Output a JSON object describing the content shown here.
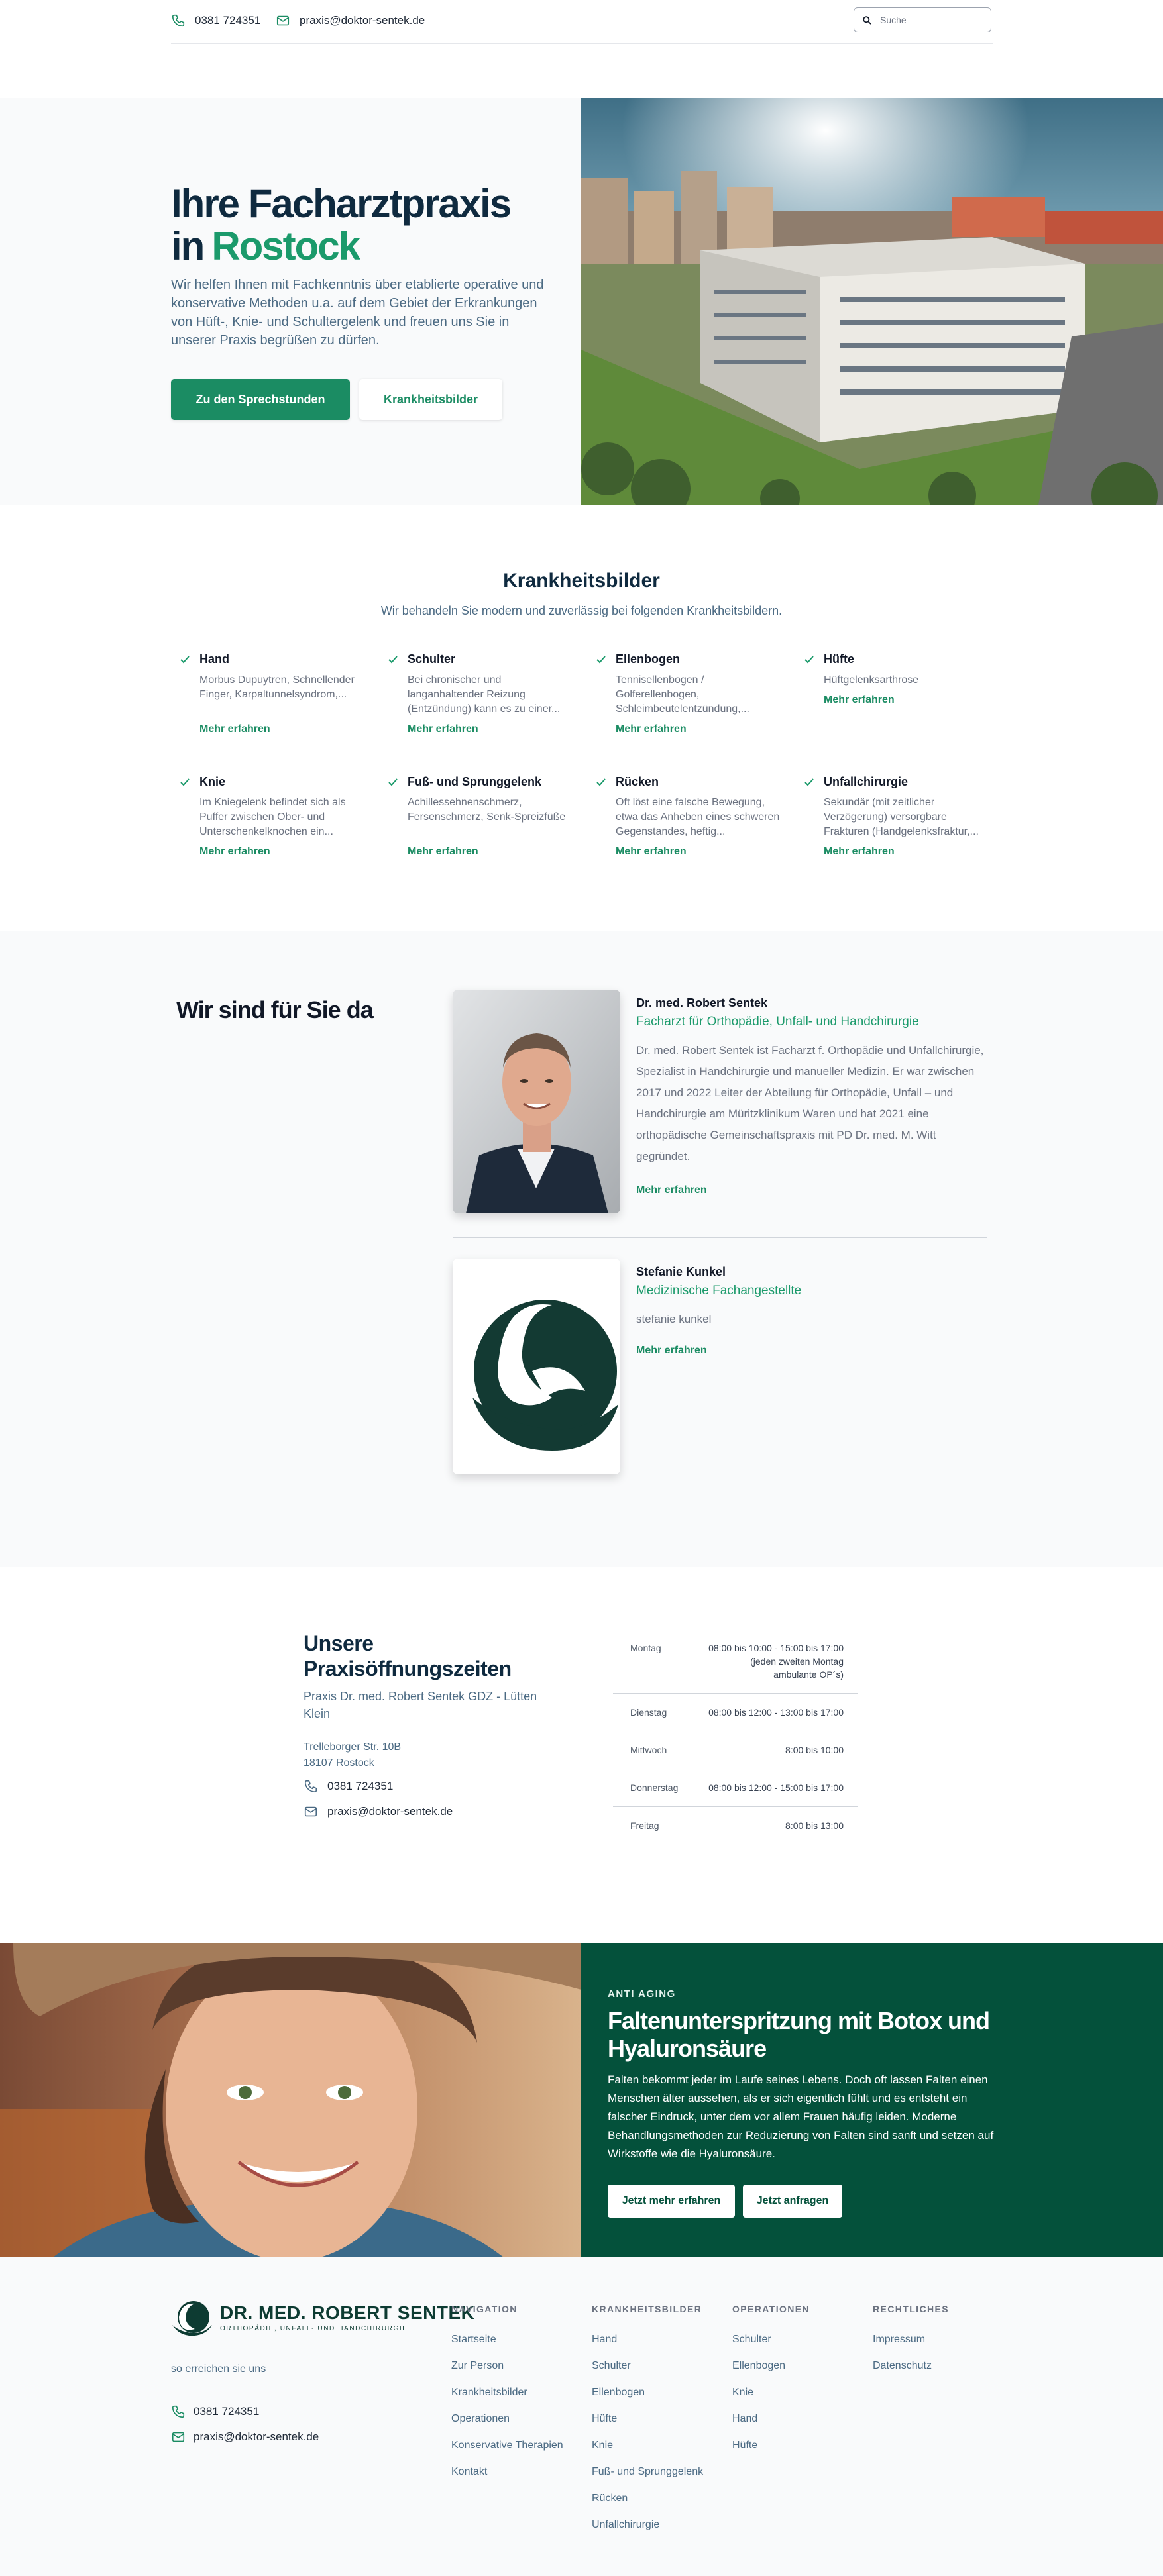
{
  "topbar": {
    "phone": "0381 724351",
    "email": "praxis@doktor-sentek.de",
    "search_placeholder": "Suche"
  },
  "hero": {
    "title_line1": "Ihre Facharztpraxis",
    "title_in": "in",
    "title_city": "Rostock",
    "lead": "Wir helfen Ihnen mit Fachkenntnis über etablierte operative und konservative Methoden u.a. auf dem Gebiet der Erkrankungen von Hüft-, Knie- und Schultergelenk und freuen uns Sie in unserer Praxis begrüßen zu dürfen.",
    "primary_button": "Zu den Sprechstunden",
    "secondary_button": "Krankheitsbilder",
    "photo_icon": "aerial-building-photo"
  },
  "conditions": {
    "title": "Krankheitsbilder",
    "subtitle": "Wir behandeln Sie modern und zuverlässig bei folgenden Krankheitsbildern.",
    "more_label": "Mehr erfahren",
    "items": [
      {
        "name": "Hand",
        "text": "Morbus Dupuytren, Schnellender Finger, Karpaltunnelsyndrom,..."
      },
      {
        "name": "Schulter",
        "text": "Bei chronischer und langanhaltender Reizung (Entzündung) kann es zu einer..."
      },
      {
        "name": "Ellenbogen",
        "text": "Tennisellenbogen / Golferellenbogen, Schleimbeutelentzündung,..."
      },
      {
        "name": "Hüfte",
        "text": "Hüftgelenksarthrose"
      },
      {
        "name": "Knie",
        "text": "Im Kniegelenk befindet sich als Puffer zwischen Ober- und Unterschenkelknochen ein..."
      },
      {
        "name": "Fuß- und Sprunggelenk",
        "text": "Achillessehnenschmerz, Fersenschmerz, Senk-Spreizfüße"
      },
      {
        "name": "Rücken",
        "text": "Oft löst eine falsche Bewegung, etwa das Anheben eines schweren Gegenstandes, heftig..."
      },
      {
        "name": "Unfallchirurgie",
        "text": "Sekundär (mit zeitlicher Verzögerung) versorgbare Frakturen (Handgelenksfraktur,..."
      }
    ]
  },
  "team": {
    "title": "Wir sind für Sie da",
    "members": [
      {
        "name": "Dr. med. Robert Sentek",
        "role": "Facharzt für Orthopädie, Unfall- und Handchirurgie",
        "bio": "Dr. med. Robert Sentek ist Facharzt f. Orthopädie und Unfallchirurgie, Spezialist in Handchirurgie und manueller Medizin. Er war zwischen 2017 und 2022 Leiter der Abteilung für Orthopädie, Unfall – und Handchirurgie am Müritzklinikum Waren und hat 2021 eine orthopädische Gemeinschaftspraxis mit PD Dr. med. M. Witt gegründet.",
        "more": "Mehr erfahren"
      },
      {
        "name": "Stefanie Kunkel",
        "role": "Medizinische Fachangestellte",
        "bio": "stefanie kunkel",
        "more": "Mehr erfahren"
      }
    ]
  },
  "hours": {
    "title": "Unsere Praxisöffnungszeiten",
    "practice": "Praxis Dr. med. Robert Sentek GDZ - Lütten Klein",
    "street": "Trelleborger Str. 10B",
    "city": "18107 Rostock",
    "phone": "0381 724351",
    "email": "praxis@doktor-sentek.de",
    "rows": [
      {
        "day": "Montag",
        "time": "08:00 bis 10:00 - 15:00 bis 17:00 (jeden zweiten Montag ambulante OP´s)"
      },
      {
        "day": "Dienstag",
        "time": "08:00 bis 12:00 - 13:00 bis 17:00"
      },
      {
        "day": "Mittwoch",
        "time": "8:00 bis 10:00"
      },
      {
        "day": "Donnerstag",
        "time": "08:00 bis 12:00 - 15:00 bis 17:00"
      },
      {
        "day": "Freitag",
        "time": "8:00 bis 13:00"
      }
    ]
  },
  "antiaging": {
    "kicker": "ANTI AGING",
    "title": "Faltenunterspritzung mit Botox und Hyaluronsäure",
    "text": "Falten bekommt jeder im Laufe seines Lebens. Doch oft lassen Falten einen Menschen älter aussehen, als er sich eigentlich fühlt und es entsteht ein falscher Eindruck, unter dem vor allem Frauen häufig leiden. Moderne Behandlungsmethoden zur Reduzierung von Falten sind sanft und setzen auf Wirkstoffe wie die Hyaluronsäure.",
    "btn_more": "Jetzt mehr erfahren",
    "btn_request": "Jetzt anfragen"
  },
  "footer": {
    "logo_name": "DR. MED. ROBERT SENTEK",
    "logo_sub": "ORTHOPÄDIE, UNFALL- UND HANDCHIRURGIE",
    "reach": "so erreichen sie uns",
    "phone": "0381 724351",
    "email": "praxis@doktor-sentek.de",
    "columns": [
      {
        "title": "NAVIGATION",
        "links": [
          "Startseite",
          "Zur Person",
          "Krankheitsbilder",
          "Operationen",
          "Konservative Therapien",
          "Kontakt"
        ]
      },
      {
        "title": "KRANKHEITSBILDER",
        "links": [
          "Hand",
          "Schulter",
          "Ellenbogen",
          "Hüfte",
          "Knie",
          "Fuß- und Sprunggelenk",
          "Rücken",
          "Unfallchirurgie"
        ]
      },
      {
        "title": "OPERATIONEN",
        "links": [
          "Schulter",
          "Ellenbogen",
          "Knie",
          "Hand",
          "Hüfte"
        ]
      },
      {
        "title": "RECHTLICHES",
        "links": [
          "Impressum",
          "Datenschutz"
        ]
      }
    ]
  },
  "colors": {
    "brand_green": "#1b8c63",
    "accent_green": "#1b9a6b",
    "dark_green": "#04513b",
    "navy": "#0f2a3f"
  }
}
